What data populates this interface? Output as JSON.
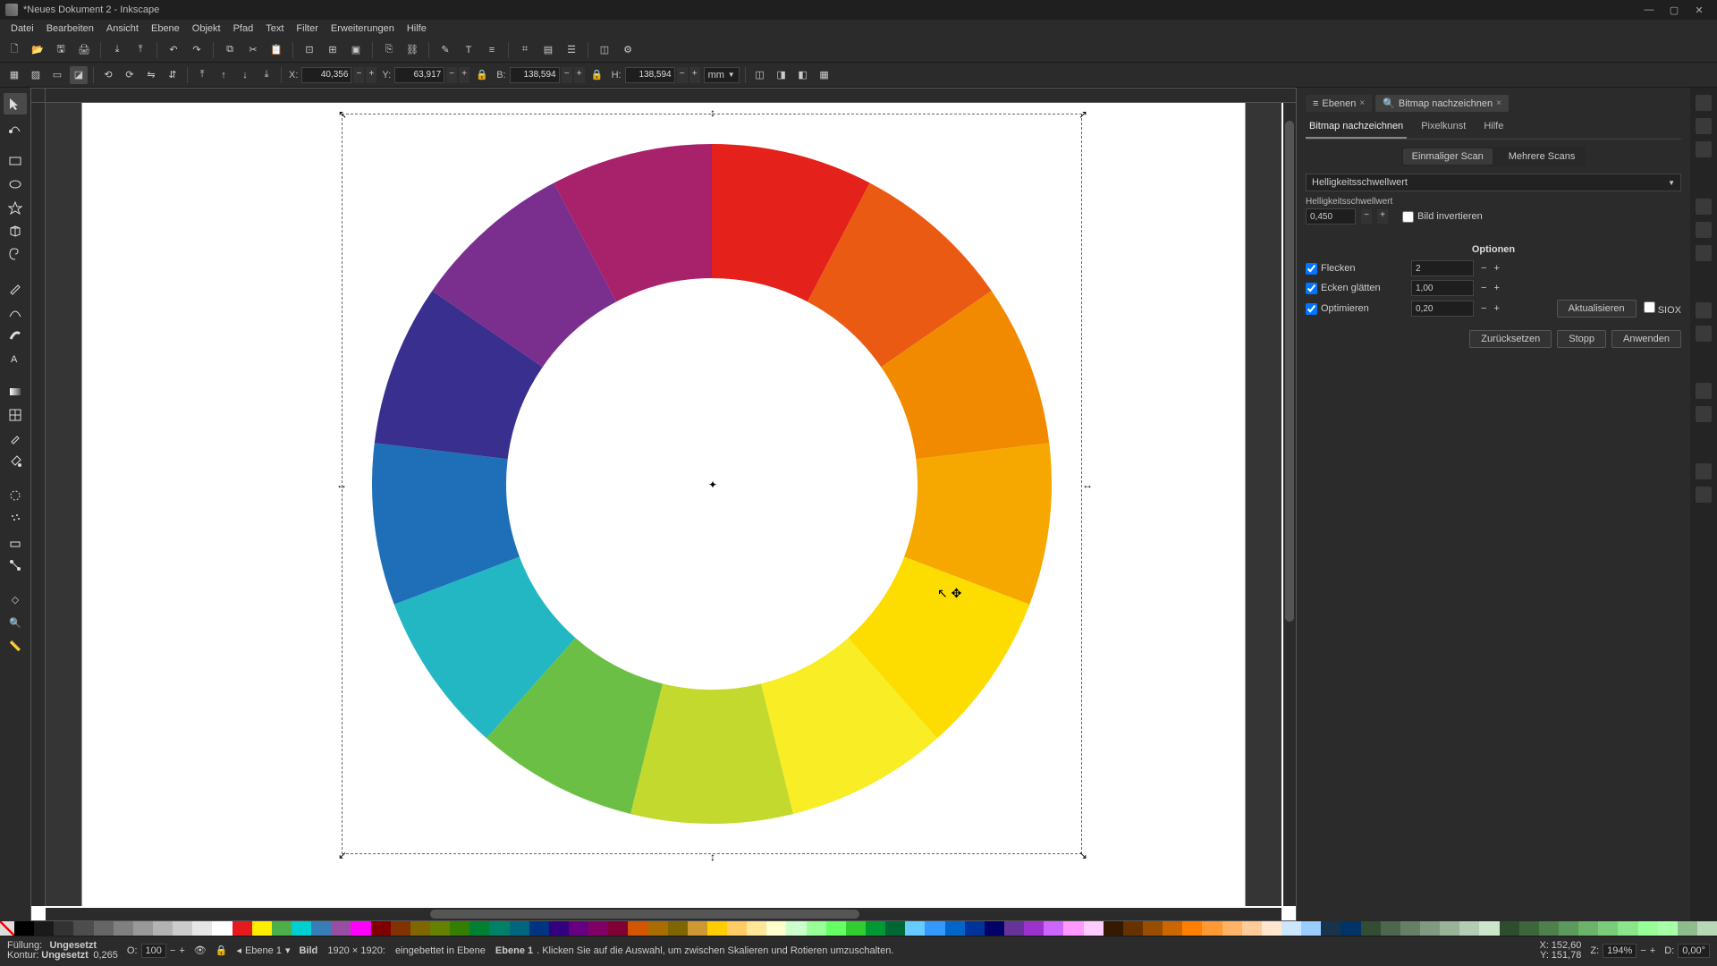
{
  "title": "*Neues Dokument 2 - Inkscape",
  "menu": [
    "Datei",
    "Bearbeiten",
    "Ansicht",
    "Ebene",
    "Objekt",
    "Pfad",
    "Text",
    "Filter",
    "Erweiterungen",
    "Hilfe"
  ],
  "coords": {
    "X_label": "X:",
    "X": "40,356",
    "Y_label": "Y:",
    "Y": "63,917",
    "B_label": "B:",
    "B": "138,594",
    "H_label": "H:",
    "H": "138,594",
    "unit": "mm"
  },
  "panel": {
    "tabs": {
      "layers": "Ebenen",
      "trace": "Bitmap nachzeichnen"
    },
    "subtabs": {
      "trace": "Bitmap nachzeichnen",
      "pixel": "Pixelkunst",
      "help": "Hilfe"
    },
    "scantabs": {
      "single": "Einmaliger Scan",
      "multi": "Mehrere Scans"
    },
    "mode": "Helligkeitsschwellwert",
    "threshold_label": "Helligkeitsschwellwert",
    "threshold": "0,450",
    "invert": "Bild invertieren",
    "options_title": "Optionen",
    "speckles": {
      "label": "Flecken",
      "val": "2"
    },
    "smooth": {
      "label": "Ecken glätten",
      "val": "1,00"
    },
    "optimize": {
      "label": "Optimieren",
      "val": "0,20"
    },
    "update": "Aktualisieren",
    "siox": "SIOX",
    "reset": "Zurücksetzen",
    "stop": "Stopp",
    "apply": "Anwenden"
  },
  "status": {
    "fill_label": "Füllung:",
    "stroke_label": "Kontur:",
    "fill": "Ungesetzt",
    "stroke": "Ungesetzt",
    "stroke_w": "0,265",
    "opacity_label": "O:",
    "opacity": "100",
    "layer": "Ebene 1",
    "sel_type": "Bild",
    "sel_dims": "1920 × 1920:",
    "sel_msg": "eingebettet in Ebene",
    "sel_layer": "Ebene 1",
    "sel_hint": ". Klicken Sie auf die Auswahl, um zwischen Skalieren und Rotieren umzuschalten.",
    "X_label": "X:",
    "X": "152,60",
    "Y_label": "Y:",
    "Y": "151,78",
    "Z_label": "Z:",
    "Z": "194%",
    "D_label": "D:",
    "D": "0,00°"
  },
  "wheel_colors": [
    "#e4211a",
    "#ea5a13",
    "#f28a00",
    "#f6a700",
    "#fddc00",
    "#f9ed25",
    "#c4d92e",
    "#6cbf45",
    "#23b7c4",
    "#1e6fb8",
    "#392f8e",
    "#7a2e8d",
    "#a8216b"
  ],
  "palette": [
    "#000000",
    "#1a1a1a",
    "#333333",
    "#4d4d4d",
    "#666666",
    "#808080",
    "#999999",
    "#b3b3b3",
    "#cccccc",
    "#e6e6e6",
    "#ffffff",
    "#e41a1c",
    "#ffed00",
    "#4daf4a",
    "#00ced1",
    "#377eb8",
    "#984ea3",
    "#ff00ff",
    "#800000",
    "#803300",
    "#806600",
    "#668000",
    "#338000",
    "#008033",
    "#008066",
    "#006680",
    "#003380",
    "#330080",
    "#660080",
    "#800066",
    "#800033",
    "#d45500",
    "#aa6e00",
    "#806600",
    "#cc9933",
    "#ffcc00",
    "#ffcc66",
    "#ffe699",
    "#ffffcc",
    "#ccffcc",
    "#99ff99",
    "#66ff66",
    "#33cc33",
    "#009933",
    "#006633",
    "#66ccff",
    "#3399ff",
    "#0066cc",
    "#003399",
    "#000066",
    "#663399",
    "#9933cc",
    "#cc66ff",
    "#ff99ff",
    "#ffccff",
    "#331a00",
    "#663300",
    "#994d00",
    "#cc6600",
    "#ff8000",
    "#ff9933",
    "#ffb366",
    "#ffcc99",
    "#ffe6cc",
    "#cce6ff",
    "#99ccff",
    "#1a334d",
    "#003366",
    "#334d33",
    "#4d664d",
    "#668066",
    "#809980",
    "#99b399",
    "#b3ccb3",
    "#cce6cc",
    "#2e4d2e",
    "#3d663d",
    "#4d804d",
    "#5c995c",
    "#6bb36b",
    "#7acc7a",
    "#89e689",
    "#98ff98",
    "#a8ffa8",
    "#8fbc8f",
    "#b8d8b8"
  ]
}
